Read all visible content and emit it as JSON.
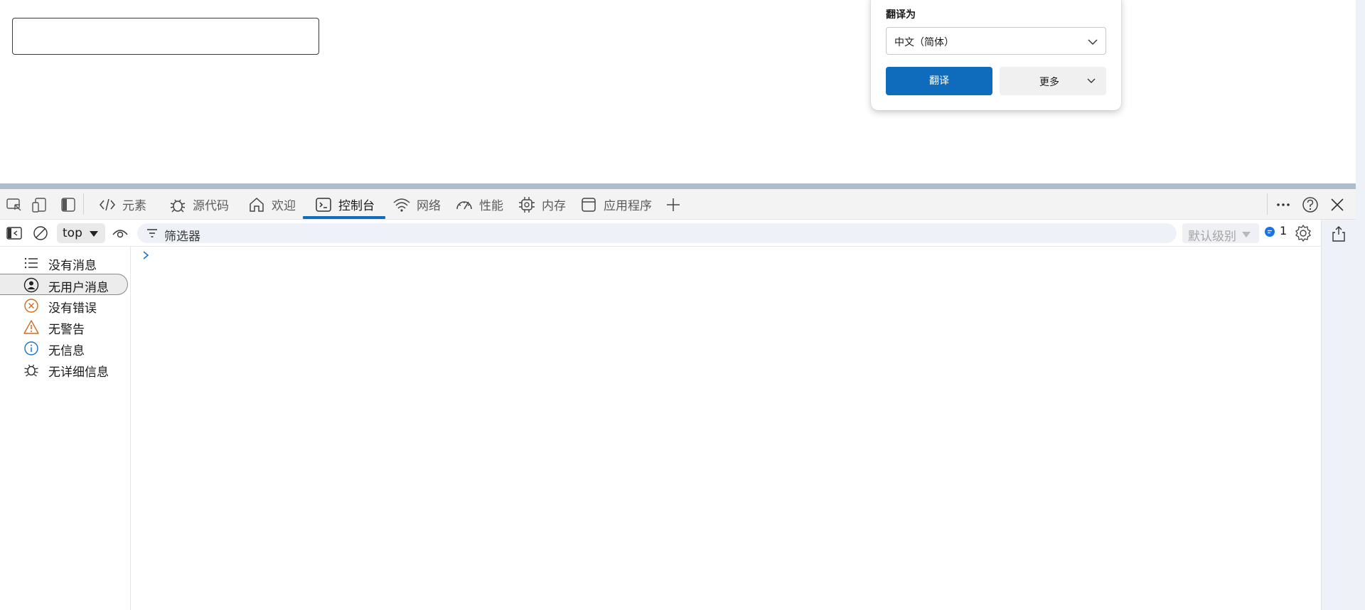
{
  "translate_popup": {
    "label": "翻译为",
    "selected_language": "中文（简体）",
    "translate_button": "翻译",
    "more_button": "更多"
  },
  "devtools": {
    "tabs": [
      {
        "label": "元素",
        "icon": "code-icon"
      },
      {
        "label": "源代码",
        "icon": "bug-icon"
      },
      {
        "label": "欢迎",
        "icon": "home-icon"
      },
      {
        "label": "控制台",
        "icon": "console-icon",
        "active": true
      },
      {
        "label": "网络",
        "icon": "wifi-icon"
      },
      {
        "label": "性能",
        "icon": "gauge-icon"
      },
      {
        "label": "内存",
        "icon": "chip-icon"
      },
      {
        "label": "应用程序",
        "icon": "app-window-icon"
      }
    ],
    "accent_color": "#0f6cbd"
  },
  "console_toolbar": {
    "context": "top",
    "filter_placeholder": "筛选器",
    "level": "默认级别",
    "issue_count": "1"
  },
  "sidebar": {
    "items": [
      {
        "label": "没有消息",
        "icon": "list-icon"
      },
      {
        "label": "无用户消息",
        "icon": "user-circle-icon",
        "selected": true
      },
      {
        "label": "没有错误",
        "icon": "error-circle-icon"
      },
      {
        "label": "无警告",
        "icon": "warning-icon"
      },
      {
        "label": "无信息",
        "icon": "info-icon"
      },
      {
        "label": "无详细信息",
        "icon": "bug-icon"
      }
    ]
  }
}
